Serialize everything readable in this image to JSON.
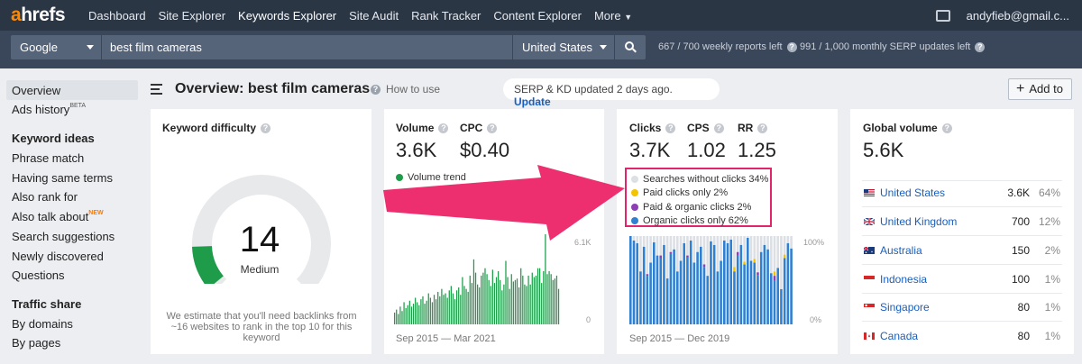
{
  "nav": {
    "logo_a": "a",
    "logo_rest": "hrefs",
    "items": [
      "Dashboard",
      "Site Explorer",
      "Keywords Explorer",
      "Site Audit",
      "Rank Tracker",
      "Content Explorer",
      "More"
    ],
    "user_email": "andyfieb@gmail.c..."
  },
  "search": {
    "engine": "Google",
    "query": "best film cameras",
    "country": "United States",
    "weekly_quota": "667 / 700 weekly reports left",
    "monthly_quota": "991 / 1,000 monthly SERP updates left"
  },
  "sidebar": {
    "overview": "Overview",
    "ads_history": "Ads history",
    "ads_history_badge": "BETA",
    "keyword_ideas_title": "Keyword ideas",
    "keyword_ideas": [
      "Phrase match",
      "Having same terms",
      "Also rank for",
      "Also talk about",
      "Search suggestions",
      "Newly discovered",
      "Questions"
    ],
    "also_talk_badge": "NEW",
    "traffic_share_title": "Traffic share",
    "traffic_share": [
      "By domains",
      "By pages"
    ]
  },
  "header": {
    "title": "Overview: best film cameras",
    "how_to": "How to use",
    "update_text": "SERP & KD updated 2 days ago.",
    "update_link": "Update",
    "add_to": "Add to"
  },
  "kd_card": {
    "title": "Keyword difficulty",
    "value": "14",
    "label": "Medium",
    "note": "We estimate that you'll need backlinks from ~16 websites to rank in the top 10 for this keyword",
    "score_fraction": 0.14,
    "color": "#1e9c4a"
  },
  "volume_card": {
    "volume_title": "Volume",
    "volume_value": "3.6K",
    "cpc_title": "CPC",
    "cpc_value": "$0.40",
    "trend_label": "Volume trend",
    "axis_max": "6.1K",
    "axis_min": "0",
    "date_range": "Sep 2015 — Mar 2021",
    "bar_color": "#1e9c4a"
  },
  "clicks_card": {
    "clicks_title": "Clicks",
    "clicks_value": "3.7K",
    "cps_title": "CPS",
    "cps_value": "1.02",
    "rr_title": "RR",
    "rr_value": "1.25",
    "legend": [
      {
        "label": "Searches without clicks 34%",
        "color": "#dcdfe4"
      },
      {
        "label": "Paid clicks only 2%",
        "color": "#f5c400"
      },
      {
        "label": "Paid & organic clicks 2%",
        "color": "#8e3fb3"
      },
      {
        "label": "Organic clicks only 62%",
        "color": "#2f80d1"
      }
    ],
    "axis_max": "100%",
    "axis_min": "0%",
    "date_range": "Sep 2015 — Dec 2019",
    "highlight_color": "#e2246c"
  },
  "global_card": {
    "title": "Global volume",
    "value": "5.6K",
    "countries": [
      {
        "name": "United States",
        "volume": "3.6K",
        "pct": "64%"
      },
      {
        "name": "United Kingdom",
        "volume": "700",
        "pct": "12%"
      },
      {
        "name": "Australia",
        "volume": "150",
        "pct": "2%"
      },
      {
        "name": "Indonesia",
        "volume": "100",
        "pct": "1%"
      },
      {
        "name": "Singapore",
        "volume": "80",
        "pct": "1%"
      },
      {
        "name": "Canada",
        "volume": "80",
        "pct": "1%"
      }
    ]
  },
  "chart_data": [
    {
      "type": "bar",
      "title": "Volume trend",
      "ylim": [
        0,
        6100
      ],
      "x_range": [
        "Sep 2015",
        "Mar 2021"
      ],
      "values": [
        800,
        1000,
        700,
        1200,
        900,
        1500,
        1100,
        1300,
        1600,
        1200,
        1400,
        1800,
        1500,
        1300,
        1700,
        1900,
        1400,
        1600,
        2100,
        1800,
        1500,
        2000,
        1700,
        2200,
        1900,
        2400,
        2000,
        2100,
        1800,
        2300,
        2600,
        2100,
        1700,
        2300,
        2500,
        2000,
        3200,
        2600,
        2400,
        2200,
        3300,
        2800,
        4400,
        3500,
        2700,
        2500,
        3300,
        3500,
        3800,
        3400,
        3000,
        2600,
        3700,
        2800,
        3200,
        3600,
        3000,
        2300,
        2700,
        4300,
        3200,
        2400,
        3400,
        2900,
        3000,
        3100,
        2500,
        3800,
        3300,
        2700,
        2600,
        3300,
        2700,
        3500,
        3200,
        3300,
        3800,
        3800,
        2800,
        3600,
        6100,
        3400,
        3600,
        3400,
        3000,
        3100,
        3300,
        2400
      ]
    },
    {
      "type": "bar",
      "title": "Clicks",
      "stacked": true,
      "ylim": [
        0,
        100
      ],
      "x_range": [
        "Sep 2015",
        "Dec 2019"
      ],
      "series": [
        {
          "name": "Organic clicks only",
          "values": [
            100,
            95,
            92,
            60,
            88,
            55,
            70,
            93,
            78,
            75,
            90,
            52,
            80,
            85,
            60,
            72,
            92,
            76,
            95,
            70,
            82,
            88,
            65,
            55,
            94,
            90,
            60,
            72,
            95,
            92,
            96,
            60,
            78,
            90,
            68,
            98,
            72,
            70,
            56,
            82,
            90,
            85,
            58,
            50,
            64,
            40,
            75,
            92,
            86
          ]
        },
        {
          "name": "Paid & organic clicks",
          "values": [
            0,
            0,
            0,
            0,
            0,
            2,
            0,
            0,
            0,
            3,
            0,
            0,
            2,
            0,
            0,
            0,
            0,
            2,
            0,
            0,
            0,
            0,
            3,
            0,
            0,
            0,
            0,
            0,
            0,
            0,
            0,
            0,
            4,
            0,
            0,
            0,
            0,
            0,
            3,
            0,
            0,
            0,
            0,
            5,
            0,
            0,
            0,
            0,
            0
          ]
        },
        {
          "name": "Paid clicks only",
          "values": [
            0,
            0,
            0,
            0,
            0,
            0,
            0,
            0,
            0,
            0,
            0,
            0,
            0,
            0,
            0,
            0,
            0,
            0,
            0,
            0,
            0,
            0,
            0,
            0,
            0,
            0,
            0,
            0,
            0,
            0,
            0,
            5,
            0,
            0,
            3,
            0,
            0,
            4,
            0,
            0,
            0,
            0,
            0,
            5,
            0,
            0,
            4,
            0,
            0
          ]
        },
        {
          "name": "Searches without clicks",
          "values": [
            0,
            5,
            8,
            40,
            12,
            43,
            30,
            7,
            22,
            22,
            10,
            48,
            18,
            15,
            40,
            28,
            8,
            22,
            5,
            30,
            18,
            12,
            32,
            45,
            6,
            10,
            40,
            28,
            5,
            8,
            4,
            35,
            18,
            10,
            29,
            2,
            28,
            26,
            41,
            18,
            10,
            15,
            42,
            40,
            36,
            60,
            21,
            8,
            14
          ]
        }
      ]
    }
  ]
}
